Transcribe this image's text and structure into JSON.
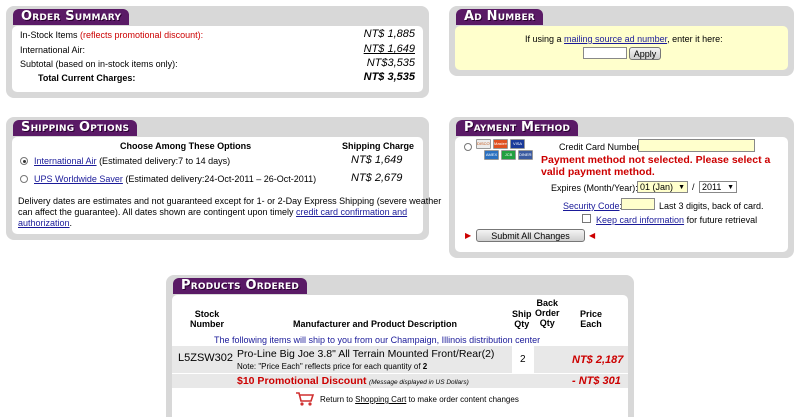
{
  "order_summary": {
    "title": "Order Summary",
    "rows": [
      {
        "label": "In-Stock Items",
        "note": "(reflects promotional discount):",
        "value": "NT$ 1,885"
      },
      {
        "label": "International Air:",
        "note": "",
        "value": "NT$ 1,649"
      },
      {
        "label": "Subtotal (based on in-stock items only):",
        "note": "",
        "value": "NT$3,535"
      }
    ],
    "total_label": "Total Current Charges:",
    "total_value": "NT$ 3,535"
  },
  "ad_number": {
    "title": "Ad Number",
    "text_before": "If using a",
    "link": "mailing source ad number",
    "text_after": ", enter it here:",
    "apply_label": "Apply"
  },
  "shipping": {
    "title": "Shipping Options",
    "col_options": "Choose Among These Options",
    "col_charge": "Shipping Charge",
    "options": [
      {
        "name": "International Air",
        "detail": "(Estimated delivery:7 to 14 days)",
        "charge": "NT$ 1,649",
        "selected": true
      },
      {
        "name": "UPS Worldwide Saver",
        "detail": "(Estimated delivery:24-Oct-2011 – 26-Oct-2011)",
        "charge": "NT$ 2,679",
        "selected": false
      }
    ],
    "note_line1": "Delivery dates are estimates and not guaranteed except for 1- or 2-Day Express Shipping (severe weather",
    "note_line2": "can affect the guarantee). All dates shown are contingent upon timely",
    "note_link1": "credit card confirmation and",
    "note_link2": "authorization",
    "note_end": "."
  },
  "payment": {
    "title": "Payment Method",
    "cc_label": "Credit Card Number:",
    "cards": [
      {
        "name": "DISCOVER",
        "color": "#e8e8e8"
      },
      {
        "name": "MasterCard",
        "color": "#e05020"
      },
      {
        "name": "VISA",
        "color": "#1a3a9a"
      },
      {
        "name": "AMEX",
        "color": "#2a70c0"
      },
      {
        "name": "JCB",
        "color": "#20a040"
      },
      {
        "name": "DINERS",
        "color": "#3a5aa0"
      }
    ],
    "error_line1": "Payment method not selected. Please select a",
    "error_line2": "valid payment method.",
    "expires_label": "Expires (Month/Year):",
    "month": "01 (Jan)",
    "slash": "/",
    "year": "2011",
    "security_link": "Security Code",
    "security_colon": ":",
    "security_hint": "Last 3 digits, back of card.",
    "keep_link": "Keep card information",
    "keep_after": "for future retrieval",
    "submit_label": "Submit All Changes"
  },
  "products": {
    "title": "Products Ordered",
    "headers": {
      "stock1": "Stock",
      "stock2": "Number",
      "desc": "Manufacturer and Product Description",
      "ship1": "Ship",
      "ship2": "Qty",
      "back1": "Back",
      "back2": "Order",
      "back3": "Qty",
      "price1": "Price",
      "price2": "Each"
    },
    "ship_note": "The following items will ship to you from our Champaign, Illinois distribution center",
    "item": {
      "stock": "L5ZSW302",
      "name": "Pro-Line Big Joe 3.8\" All Terrain Mounted Front/Rear(2)",
      "note_prefix": "Note: \"Price Each\" reflects price for each quantity of",
      "note_qty": "2",
      "qty": "2",
      "price": "NT$ 2,187"
    },
    "promo_label": "$10 Promotional Discount",
    "promo_small": "(Message displayed in US Dollars)",
    "promo_value": "- NT$ 301",
    "cart_before": "Return to",
    "cart_link": "Shopping Cart",
    "cart_after": "to make order content changes"
  }
}
